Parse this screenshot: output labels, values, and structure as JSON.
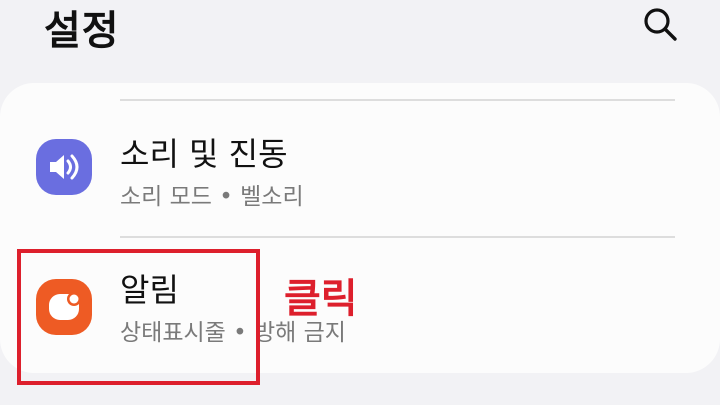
{
  "header": {
    "title": "설정",
    "search_icon": "search-icon"
  },
  "settings": {
    "items": [
      {
        "title": "소리 및 진동",
        "subtitle": "소리 모드 • 벨소리",
        "icon": "sound-vibration-icon",
        "icon_color": "#6a6ee0"
      },
      {
        "title": "알림",
        "subtitle": "상태표시줄 • 방해 금지",
        "icon": "notifications-icon",
        "icon_color": "#ee5b24"
      }
    ]
  },
  "annotation": {
    "label": "클릭",
    "color": "#dd1f2c"
  }
}
